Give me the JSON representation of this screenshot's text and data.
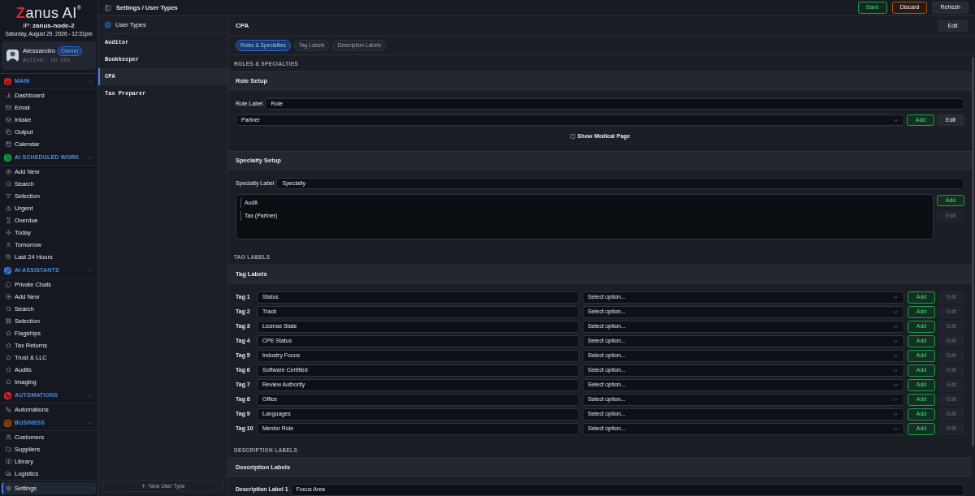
{
  "brand": {
    "name": "Zanus AI",
    "mark": "®"
  },
  "node": {
    "label": "IP:",
    "value": "zanus-node-2"
  },
  "datetime": "Saturday, August 29, 2026 - 12:31pm",
  "user": {
    "name": "Alessandro",
    "role": "Owner",
    "active": "Active: 1m 25s"
  },
  "sidebar": {
    "sections": [
      {
        "title": "MAIN",
        "color": "#dc2626",
        "expanded": true,
        "items": [
          {
            "label": "Dashboard",
            "selected": false
          },
          {
            "label": "Email",
            "selected": false
          },
          {
            "label": "Intake",
            "selected": false
          },
          {
            "label": "Output",
            "selected": false
          },
          {
            "label": "Calendar",
            "selected": false
          }
        ]
      },
      {
        "title": "AI SCHEDULED WORK",
        "color": "#16a34a",
        "expanded": true,
        "items": [
          {
            "label": "Add New",
            "selected": false
          },
          {
            "label": "Search",
            "selected": false
          },
          {
            "label": "Selection",
            "selected": false
          },
          {
            "label": "Urgent",
            "selected": false
          },
          {
            "label": "Overdue",
            "selected": false
          },
          {
            "label": "Today",
            "selected": false
          },
          {
            "label": "Tomorrow",
            "selected": false
          },
          {
            "label": "Last 24 Hours",
            "selected": false
          }
        ]
      },
      {
        "title": "AI ASSISTANTS",
        "color": "#3b82f6",
        "expanded": true,
        "items": [
          {
            "label": "Private Chats",
            "selected": false
          },
          {
            "label": "Add New",
            "selected": false
          },
          {
            "label": "Search",
            "selected": false
          },
          {
            "label": "Selection",
            "selected": false
          },
          {
            "label": "Flagships",
            "selected": false
          },
          {
            "label": "Tax Returns",
            "selected": false
          },
          {
            "label": "Trust & LLC",
            "selected": false
          },
          {
            "label": "Audits",
            "selected": false
          },
          {
            "label": "Imaging",
            "selected": false
          }
        ]
      },
      {
        "title": "AUTOMATIONS",
        "color": "#dc2626",
        "expanded": true,
        "items": [
          {
            "label": "Automations",
            "selected": false
          }
        ]
      },
      {
        "title": "BUSINESS",
        "color": "#b45309",
        "expanded": true,
        "items": [
          {
            "label": "Customers",
            "selected": false
          },
          {
            "label": "Suppliers",
            "selected": false
          },
          {
            "label": "Library",
            "selected": false
          },
          {
            "label": "Logistics",
            "selected": false
          }
        ]
      }
    ],
    "footer": {
      "label": "Settings",
      "selected": true
    }
  },
  "breadcrumb": "Settings / User Types",
  "actions": [
    {
      "label": "Save",
      "kind": "save"
    },
    {
      "label": "Discard",
      "kind": "discard"
    },
    {
      "label": "Refresh",
      "kind": "neutral"
    }
  ],
  "user_types": {
    "title": "User Types",
    "items": [
      {
        "label": "Auditor",
        "selected": false
      },
      {
        "label": "Bookkeeper",
        "selected": false
      },
      {
        "label": "CPA",
        "selected": true
      },
      {
        "label": "Tax Preparer",
        "selected": false
      }
    ],
    "new_button": "New User Type"
  },
  "detail": {
    "title": "CPA",
    "edit": "Edit",
    "tabs": [
      {
        "label": "Roles & Specialties",
        "selected": true
      },
      {
        "label": "Tag Labels",
        "selected": false
      },
      {
        "label": "Description Labels",
        "selected": false
      }
    ],
    "roles": {
      "section": "ROLES & SPECIALTIES",
      "role_setup": {
        "title": "Role Setup",
        "label": "Role Label",
        "value": "Role",
        "select": "Partner",
        "add": "Add",
        "edit": {
          "label": "Edit",
          "disabled": false
        },
        "checkbox": {
          "label": "Show Medical Page",
          "checked": false
        }
      },
      "specialty_setup": {
        "title": "Specialty Setup",
        "label": "Specialty Label",
        "value": "Specialty",
        "items": [
          "Audit",
          "Tax (Partner)"
        ],
        "add": "Add",
        "edit": {
          "label": "Edit",
          "disabled": true
        }
      }
    },
    "tags": {
      "section": "TAG LABELS",
      "title": "Tag Labels",
      "rows": [
        {
          "label": "Tag 1",
          "value": "Status",
          "placeholder": "Select option...",
          "add": "Add",
          "edit": {
            "label": "Edit",
            "disabled": true
          }
        },
        {
          "label": "Tag 2",
          "value": "Track",
          "placeholder": "Select option...",
          "add": "Add",
          "edit": {
            "label": "Edit",
            "disabled": true
          }
        },
        {
          "label": "Tag 3",
          "value": "License State",
          "placeholder": "Select option...",
          "add": "Add",
          "edit": {
            "label": "Edit",
            "disabled": true
          }
        },
        {
          "label": "Tag 4",
          "value": "CPE Status",
          "placeholder": "Select option...",
          "add": "Add",
          "edit": {
            "label": "Edit",
            "disabled": true
          }
        },
        {
          "label": "Tag 5",
          "value": "Industry Focus",
          "placeholder": "Select option...",
          "add": "Add",
          "edit": {
            "label": "Edit",
            "disabled": true
          }
        },
        {
          "label": "Tag 6",
          "value": "Software Certified",
          "placeholder": "Select option...",
          "add": "Add",
          "edit": {
            "label": "Edit",
            "disabled": true
          }
        },
        {
          "label": "Tag 7",
          "value": "Review Authority",
          "placeholder": "Select option...",
          "add": "Add",
          "edit": {
            "label": "Edit",
            "disabled": true
          }
        },
        {
          "label": "Tag 8",
          "value": "Office",
          "placeholder": "Select option...",
          "add": "Add",
          "edit": {
            "label": "Edit",
            "disabled": true
          }
        },
        {
          "label": "Tag 9",
          "value": "Languages",
          "placeholder": "Select option...",
          "add": "Add",
          "edit": {
            "label": "Edit",
            "disabled": true
          }
        },
        {
          "label": "Tag 10",
          "value": "Mentor Role",
          "placeholder": "Select option...",
          "add": "Add",
          "edit": {
            "label": "Edit",
            "disabled": true
          }
        }
      ]
    },
    "descriptions": {
      "section": "DESCRIPTION LABELS",
      "title": "Description Labels",
      "rows": [
        {
          "label": "Description Label 1",
          "value": "Focus Area"
        }
      ]
    }
  }
}
